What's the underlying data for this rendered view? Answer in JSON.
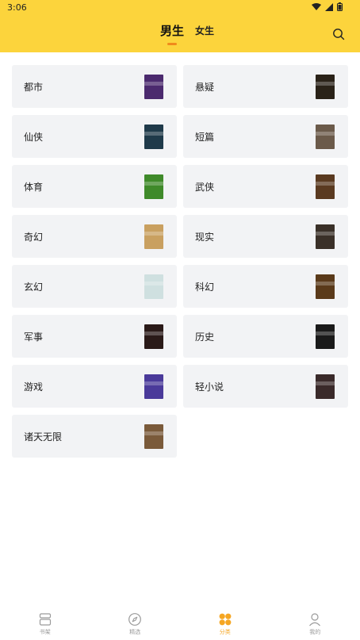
{
  "status_bar": {
    "time": "3:06"
  },
  "header": {
    "tabs": [
      {
        "label": "男生",
        "active": true
      },
      {
        "label": "女生",
        "active": false
      }
    ],
    "search_icon": "search-icon"
  },
  "categories": [
    {
      "label": "都市",
      "cover_color": "#4b2a6e"
    },
    {
      "label": "悬疑",
      "cover_color": "#2a2218"
    },
    {
      "label": "仙侠",
      "cover_color": "#1f3a4a"
    },
    {
      "label": "短篇",
      "cover_color": "#6b5a4a"
    },
    {
      "label": "体育",
      "cover_color": "#3f8a2a"
    },
    {
      "label": "武侠",
      "cover_color": "#5a3a20"
    },
    {
      "label": "奇幻",
      "cover_color": "#c9a060"
    },
    {
      "label": "现实",
      "cover_color": "#3a3028"
    },
    {
      "label": "玄幻",
      "cover_color": "#cfe0e0"
    },
    {
      "label": "科幻",
      "cover_color": "#5a3a1a"
    },
    {
      "label": "军事",
      "cover_color": "#2a1a18"
    },
    {
      "label": "历史",
      "cover_color": "#1a1a1a"
    },
    {
      "label": "游戏",
      "cover_color": "#4a3a9a"
    },
    {
      "label": "轻小说",
      "cover_color": "#3a2a2a"
    },
    {
      "label": "诸天无限",
      "cover_color": "#7a5a3a"
    }
  ],
  "bottom_nav": [
    {
      "label": "书架",
      "icon": "bookshelf-icon",
      "active": false
    },
    {
      "label": "精选",
      "icon": "compass-icon",
      "active": false
    },
    {
      "label": "分类",
      "icon": "category-icon",
      "active": true
    },
    {
      "label": "我的",
      "icon": "profile-icon",
      "active": false
    }
  ],
  "colors": {
    "header_bg": "#fcd43c",
    "accent": "#f5a623",
    "card_bg": "#f2f3f5"
  }
}
